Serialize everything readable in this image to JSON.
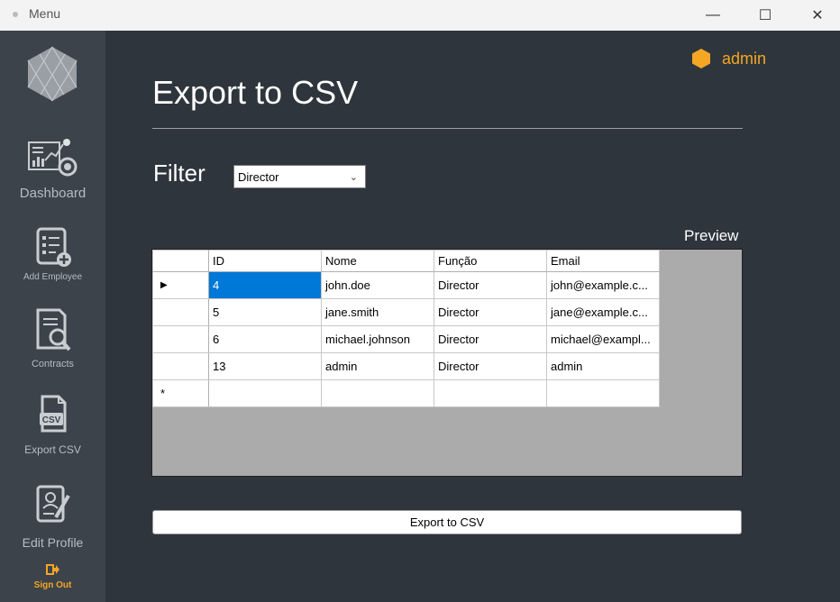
{
  "window": {
    "title": "Menu",
    "minimize": "—",
    "maximize": "☐",
    "close": "✕"
  },
  "user": {
    "name": "admin",
    "accent": "#f5a623"
  },
  "sidebar": {
    "items": [
      {
        "label": "Dashboard",
        "icon": "dashboard-icon"
      },
      {
        "label": "Add Employee",
        "icon": "add-employee-icon"
      },
      {
        "label": "Contracts",
        "icon": "contracts-icon"
      },
      {
        "label": "Export CSV",
        "icon": "csv-icon"
      },
      {
        "label": "Edit Profile",
        "icon": "edit-profile-icon"
      },
      {
        "label": "Sign Out",
        "icon": "sign-out-icon",
        "color": "#f5a623"
      }
    ]
  },
  "main": {
    "title": "Export to CSV",
    "filter_label": "Filter",
    "filter_value": "Director",
    "preview_label": "Preview",
    "table": {
      "columns": [
        "ID",
        "Nome",
        "Função",
        "Email"
      ],
      "rows": [
        [
          "4",
          "john.doe",
          "Director",
          "john@example.c..."
        ],
        [
          "5",
          "jane.smith",
          "Director",
          "jane@example.c..."
        ],
        [
          "6",
          "michael.johnson",
          "Director",
          "michael@exampl..."
        ],
        [
          "13",
          "admin",
          "Director",
          "admin"
        ]
      ],
      "current_row_marker": "▶",
      "new_row_marker": "*"
    },
    "export_button": "Export to CSV"
  }
}
